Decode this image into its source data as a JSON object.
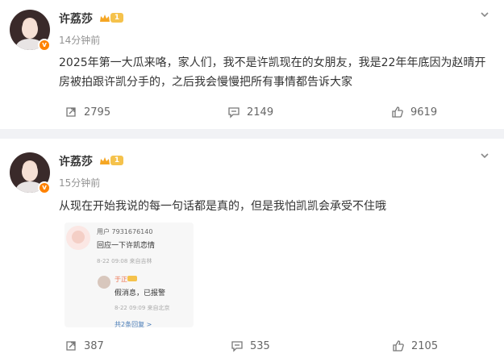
{
  "posts": [
    {
      "author": "许荔莎",
      "level": "1",
      "time": "14分钟前",
      "text": "2025年第一大瓜来咯，家人们，我不是许凯现在的女朋友，我是22年年底因为赵晴开房被拍跟许凯分手的，之后我会慢慢把所有事情都告诉大家",
      "reposts": "2795",
      "comments": "2149",
      "likes": "9619"
    },
    {
      "author": "许荔莎",
      "level": "1",
      "time": "15分钟前",
      "text": "从现在开始我说的每一句话都是真的，但是我怕凯凯会承受不住哦",
      "embed": {
        "user": "用户 7931676140",
        "message": "回应一下许凯恋情",
        "meta": "8-22 09:08 来自吉林",
        "reply_name": "于正",
        "reply_message": "假消息，已报警",
        "reply_meta": "8-22 09:09 来自北京",
        "more": "共2条回复 >"
      },
      "reposts": "387",
      "comments": "535",
      "likes": "2105"
    }
  ],
  "colors": {
    "accent": "#ff8200",
    "level_badge": "#f5c24c",
    "divider": "#f1f2f5"
  },
  "icons": [
    "repost-icon",
    "comment-icon",
    "like-icon",
    "chevron-down-icon",
    "crown-icon",
    "verified-badge-icon"
  ]
}
